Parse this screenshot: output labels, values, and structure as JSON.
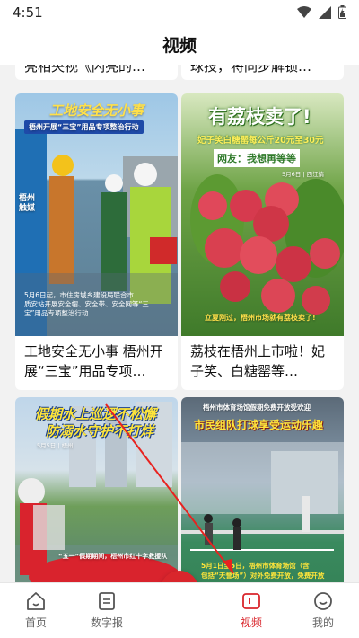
{
  "status": {
    "time": "4:51",
    "icons": [
      "wifi-icon",
      "signal-icon",
      "battery-icon"
    ]
  },
  "header": {
    "title": "视频"
  },
  "cards_top_partial": [
    {
      "title_tail": "亮相央视《闪亮的…"
    },
    {
      "title_tail": "球技，将同步解锁…"
    }
  ],
  "cards": [
    {
      "title": "工地安全无小事 梧州开展“三宝”用品专项…",
      "thumb": {
        "headline": "工地安全无小事",
        "banner": "梧州开展“三宝”用品专项整治行动",
        "logo": "梧州 触媒",
        "caption_lines": [
          "5月6日起，市住房城乡建设局联合市",
          "质安站开展安全帽、安全带、安全网等“三",
          "宝”用品专项整治行动"
        ]
      }
    },
    {
      "title": "荔枝在梧州上市啦！妃子笑、白糖罂等…",
      "thumb": {
        "headline": "有荔枝卖了!",
        "banner": "妃子笑白糖罂每公斤20元至30元",
        "sub": "网友：我想再等等",
        "date": "5月6日 | 西江情",
        "footer": "立夏刚过，梧州市场就有荔枝卖了!"
      }
    },
    {
      "thumb": {
        "headline": "假期水上巡逻不松懈",
        "sub": "防溺水守护不打烊",
        "date": "5月5日 | 梧州",
        "footer": "“五一”假期期间，梧州市红十字救援队"
      }
    },
    {
      "thumb": {
        "banner": "梧州市体育场馆假期免费开放受欢迎",
        "headline": "市民组队打球享受运动乐趣",
        "caption_lines": [
          "5月1日至5日，梧州市体育场馆（含",
          "包括“天誉场”）对外免费开放，免费开放"
        ]
      }
    }
  ],
  "navbar": {
    "items": [
      {
        "label": "首页",
        "icon": "home-icon",
        "active": false
      },
      {
        "label": "数字报",
        "icon": "newspaper-icon",
        "active": false
      },
      {
        "label": "",
        "icon": "play-center-icon",
        "active": false
      },
      {
        "label": "视频",
        "icon": "video-icon",
        "active": true
      },
      {
        "label": "我的",
        "icon": "profile-icon",
        "active": false
      }
    ]
  },
  "colors": {
    "accent": "#d9262c",
    "background": "#f2f2f2"
  }
}
